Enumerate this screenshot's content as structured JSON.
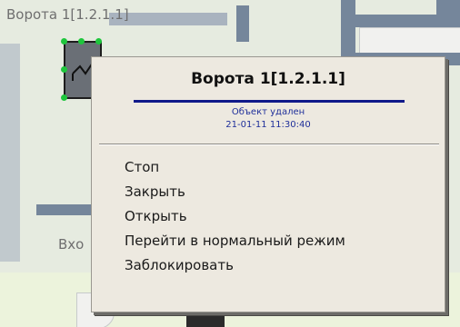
{
  "map": {
    "gate_label": "Ворота 1[1.2.1.1]",
    "entrance_label": "Вхо"
  },
  "context_menu": {
    "title": "Ворота 1[1.2.1.1]",
    "status_lines": [
      "Объект удален",
      "21-01-11 11:30:40"
    ],
    "items": [
      {
        "label": "Стоп"
      },
      {
        "label": "Закрыть"
      },
      {
        "label": "Открыть"
      },
      {
        "label": "Перейти в нормальный режим"
      },
      {
        "label": "Заблокировать"
      }
    ],
    "title_rule_color": "#101a8a",
    "status_text_color": "#1f2f9a"
  }
}
